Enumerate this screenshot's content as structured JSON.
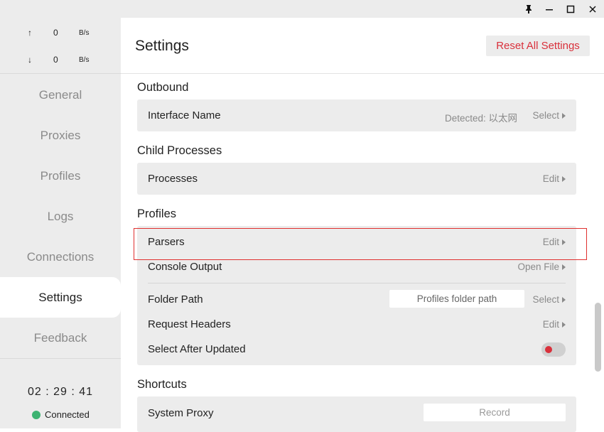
{
  "window": {
    "pin_icon": "pin-icon",
    "min_icon": "minimize-icon",
    "max_icon": "maximize-icon",
    "close_icon": "close-icon"
  },
  "sidebar": {
    "upload": {
      "arrow": "↑",
      "value": "0",
      "unit": "B/s"
    },
    "download": {
      "arrow": "↓",
      "value": "0",
      "unit": "B/s"
    },
    "nav": [
      {
        "label": "General",
        "active": false
      },
      {
        "label": "Proxies",
        "active": false
      },
      {
        "label": "Profiles",
        "active": false
      },
      {
        "label": "Logs",
        "active": false
      },
      {
        "label": "Connections",
        "active": false
      },
      {
        "label": "Settings",
        "active": true
      },
      {
        "label": "Feedback",
        "active": false
      }
    ],
    "clock": "02 : 29 : 41",
    "status": "Connected",
    "status_color": "#3cb371"
  },
  "header": {
    "title": "Settings",
    "reset_label": "Reset All Settings",
    "reset_color": "#d9303b"
  },
  "sections": {
    "outbound": {
      "title": "Outbound",
      "interface_label": "Interface Name",
      "interface_detected": "Detected: 以太网",
      "interface_action": "Select"
    },
    "child_processes": {
      "title": "Child Processes",
      "processes_label": "Processes",
      "processes_action": "Edit"
    },
    "profiles": {
      "title": "Profiles",
      "parsers_label": "Parsers",
      "parsers_action": "Edit",
      "console_label": "Console Output",
      "console_action": "Open File",
      "folder_label": "Folder Path",
      "folder_placeholder": "Profiles folder path",
      "folder_action": "Select",
      "headers_label": "Request Headers",
      "headers_action": "Edit",
      "select_after_label": "Select After Updated",
      "select_after_on": false
    },
    "shortcuts": {
      "title": "Shortcuts",
      "system_proxy_label": "System Proxy",
      "record_label": "Record"
    }
  },
  "highlight_color": "#e0302f"
}
